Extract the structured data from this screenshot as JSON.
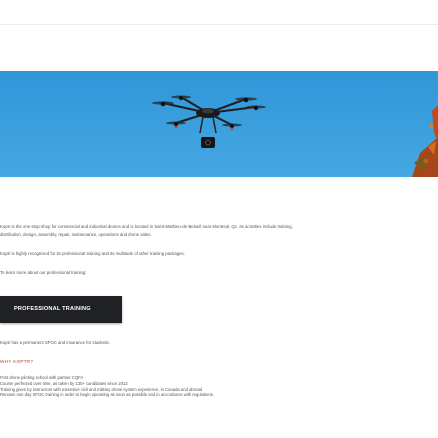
{
  "colors": {
    "hero_sky": "#3a9fde",
    "button_bg": "#1f2124",
    "heading_accent": "#c0392b"
  },
  "intro": {
    "line1": "Koptr is the one-stop-shop for commercial and industrial drones and is located in Saint-Mathieu-de-Beloeil near Montreal, Qc. Its activities include training,",
    "line2": "distribution, design, assembly, repair, maintenance, operations and drone sales.",
    "line3": "Koptr is highly recognized for its professional training and its multitude of other training packages.",
    "line4": "To learn more about our professional training:"
  },
  "cta": {
    "label": "PROFESSIONAL TRAINING"
  },
  "permanent_note": "Koptr has a permanent SFOC and insurance for students.",
  "why": {
    "heading": "WHY KOPTR?",
    "items": [
      "First drone piloting school with partner CQFA",
      "Course perfected over time, as taken by 130+ candidates since 2012",
      "Training given by instructors with extensive civil and military drone system experience, in Canada and abroad",
      "Renown one day SFOC training in order to begin operating as soon as possible and in accordance with regulations."
    ]
  }
}
